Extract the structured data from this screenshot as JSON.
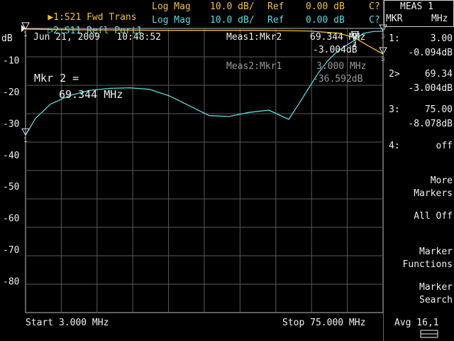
{
  "header": {
    "trace1": {
      "marker": "▶1:",
      "name": "S21 Fwd Trans",
      "format": "Log Mag",
      "scale": "10.0 dB/",
      "ref_label": "Ref",
      "ref_value": "0.00 dB",
      "cal": "C?"
    },
    "trace2": {
      "marker": "▷2:",
      "name": "S11 Refl Port1",
      "format": "Log Mag",
      "scale": "10.0 dB/",
      "ref_label": "Ref",
      "ref_value": "0.00 dB",
      "cal": "C?"
    }
  },
  "plot": {
    "unit": "dB",
    "timestamp": "Jun 21, 2009   10:48:52",
    "meas1_label": "Meas1:Mkr2",
    "meas1_freq": "69.344 MHz",
    "meas1_value": "-3.004dB",
    "meas2_label": "Meas2:Mkr1",
    "meas2_freq": "3.000 MHz",
    "meas2_value": "-36.592dB",
    "mkr_title": "Mkr 2 =",
    "mkr_value": "69.344 MHz",
    "start": "Start 3.000 MHz",
    "stop": "Stop 75.000 MHz",
    "ytick_labels": [
      "-10",
      "-20",
      "-30",
      "-40",
      "-50",
      "-60",
      "-70",
      "-80"
    ]
  },
  "softkeys": {
    "meas_title": "MEAS 1",
    "col_mkr": "MKR",
    "col_mhz": "MHz",
    "markers": [
      {
        "label": "1:",
        "freq": "3.00",
        "value": "-0.094dB"
      },
      {
        "label": "2>",
        "freq": "69.34",
        "value": "-3.004dB"
      },
      {
        "label": "3:",
        "freq": "75.00",
        "value": "-8.078dB"
      },
      {
        "label": "4:",
        "freq": "off",
        "value": ""
      }
    ],
    "more_markers": [
      "More",
      "Markers"
    ],
    "all_off": "All Off",
    "marker_functions": [
      "Marker",
      "Functions"
    ],
    "marker_search": [
      "Marker",
      "Search"
    ],
    "avg": "Avg 16,1"
  },
  "colors": {
    "trace1": "#f0c040",
    "trace2": "#5fd7e0",
    "grid": "#5a5a5a",
    "text": "#f0f0f0"
  },
  "chart_data": {
    "type": "line",
    "title": "",
    "xlabel": "",
    "ylabel": "dB",
    "xlim": [
      3,
      75
    ],
    "ylim": [
      -90,
      0
    ],
    "x_unit": "MHz",
    "grid": true,
    "series": [
      {
        "name": "S21 Fwd Trans",
        "x": [
          3,
          10,
          20,
          30,
          40,
          50,
          60,
          66,
          69.344,
          72,
          75
        ],
        "y": [
          -0.2,
          -0.4,
          -0.5,
          -0.6,
          -0.6,
          -0.6,
          -0.8,
          -1.5,
          -3.0,
          -5.5,
          -8.1
        ]
      },
      {
        "name": "S11 Refl Port1",
        "x": [
          3,
          5,
          8,
          12,
          16,
          20,
          24,
          28,
          32,
          36,
          40,
          44,
          48,
          52,
          56,
          58,
          60,
          62,
          64,
          66,
          68,
          69.344,
          71,
          73,
          75
        ],
        "y": [
          -33.8,
          -28.5,
          -24.0,
          -21.2,
          -19.6,
          -19.0,
          -18.8,
          -19.3,
          -21.4,
          -24.5,
          -27.6,
          -27.9,
          -26.6,
          -25.9,
          -28.8,
          -24.0,
          -19.0,
          -14.0,
          -10.0,
          -7.0,
          -5.0,
          -3.6,
          -1.6,
          -1.0,
          -0.9
        ]
      }
    ],
    "markers": [
      {
        "label": "1",
        "x": 3.0
      },
      {
        "label": "2",
        "x": 69.344
      },
      {
        "label": "3",
        "x": 75.0
      }
    ]
  }
}
